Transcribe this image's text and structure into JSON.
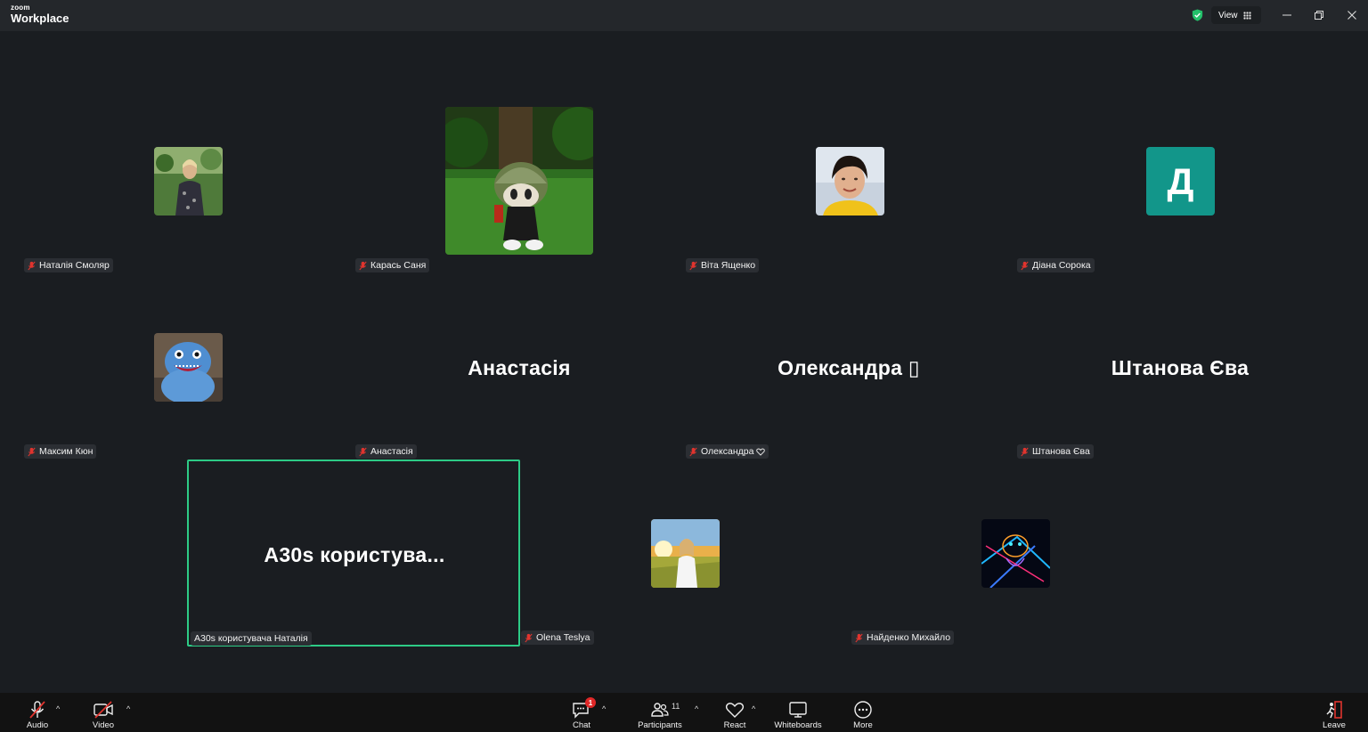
{
  "app": {
    "brand_small": "zoom",
    "brand_big": "Workplace",
    "view_label": "View"
  },
  "colors": {
    "accent_active": "#2dcb86",
    "letter_avatar_bg": "#12968a",
    "muted_red": "#e0342e",
    "badge_red": "#e02828"
  },
  "participants": [
    {
      "name": "Наталія Смоляр",
      "avatar": "photo-woman-green-background"
    },
    {
      "name": "Карась Саня",
      "avatar": "game-character-hedgehog"
    },
    {
      "name": "Віта Ященко",
      "avatar": "photo-woman-portrait"
    },
    {
      "name": "Діана Сорока",
      "avatar_letter": "Д"
    },
    {
      "name": "Максим Кюн",
      "avatar": "blue-plush-toy"
    },
    {
      "name": "Анастасія",
      "display_name": "Анастасія"
    },
    {
      "name": "Олександра",
      "display_name": "Олександра ▯",
      "name_suffix_icon": "heart-icon"
    },
    {
      "name": "Штанова Єва",
      "display_name": "Штанова Єва"
    },
    {
      "name": "A30s користувача Наталія",
      "display_name": "A30s  користува..."
    },
    {
      "name": "Olena Teslya",
      "avatar": "photo-girl-sunset-field"
    },
    {
      "name": "Найденко Михайло",
      "avatar": "neon-raccoon-art"
    }
  ],
  "toolbar": {
    "audio": "Audio",
    "video": "Video",
    "chat": "Chat",
    "chat_badge": "1",
    "participants": "Participants",
    "participants_count": "11",
    "react": "React",
    "whiteboards": "Whiteboards",
    "more": "More",
    "leave": "Leave"
  }
}
